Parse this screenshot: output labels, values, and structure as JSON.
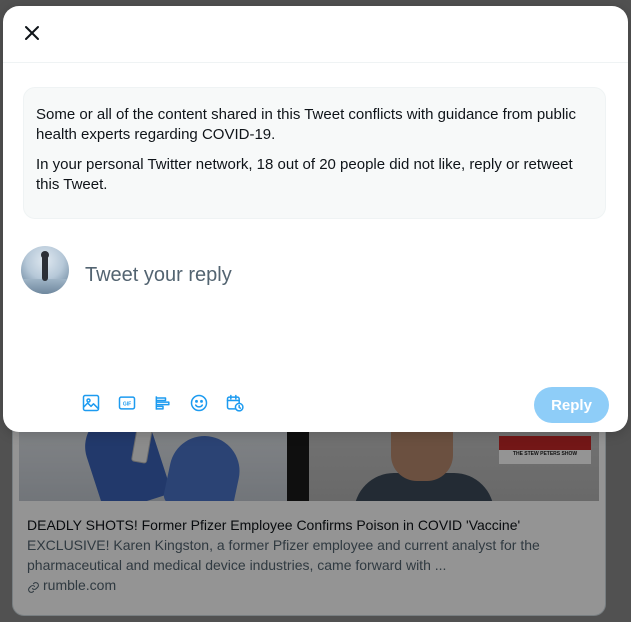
{
  "modal": {
    "close_icon": "close-icon",
    "notice": {
      "line1": "Some or all of the content shared in this Tweet conflicts with guidance from public health experts regarding COVID-19.",
      "line2": "In your personal Twitter network, 18 out of 20 people did not like, reply or retweet this Tweet."
    },
    "compose": {
      "placeholder": "Tweet your reply",
      "avatar": "avatar-image"
    },
    "toolbar": {
      "icons": [
        "image-icon",
        "gif-icon",
        "poll-icon",
        "emoji-icon",
        "schedule-icon"
      ]
    },
    "reply_button": "Reply",
    "accent_color": "#1d9bf0",
    "reply_button_color": "#8ecdf8"
  },
  "background_card": {
    "show_logo_text": "THE STEW PETERS SHOW",
    "title": "DEADLY SHOTS! Former Pfizer Employee Confirms Poison in COVID 'Vaccine'",
    "description": "EXCLUSIVE! Karen Kingston, a former Pfizer employee and current analyst for the pharmaceutical and medical device industries, came forward with ...",
    "domain": "rumble.com",
    "link_icon": "link-icon"
  }
}
